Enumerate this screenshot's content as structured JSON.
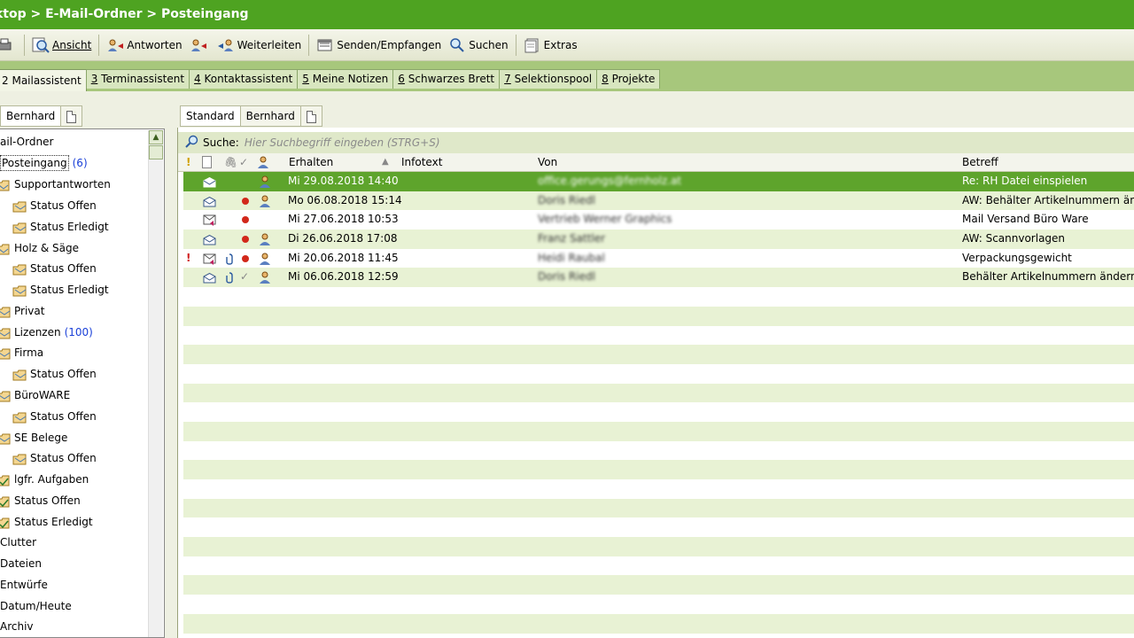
{
  "title": "ktop > E-Mail-Ordner > Posteingang",
  "toolbar": {
    "buttons": [
      {
        "label": "Ansicht",
        "icon": "view-icon"
      },
      {
        "label": "Antworten",
        "icon": "reply-icon"
      },
      {
        "label": "Weiterleiten",
        "icon": "forward-icon"
      },
      {
        "label": "Senden/Empfangen",
        "icon": "send-receive-icon"
      },
      {
        "label": "Suchen",
        "icon": "search-icon"
      },
      {
        "label": "Extras",
        "icon": "extras-icon"
      }
    ]
  },
  "main_tabs": [
    {
      "num": "2",
      "label": "Mailassistent"
    },
    {
      "num": "3",
      "label": "Terminassistent"
    },
    {
      "num": "4",
      "label": "Kontaktassistent"
    },
    {
      "num": "5",
      "label": "Meine Notizen"
    },
    {
      "num": "6",
      "label": "Schwarzes Brett"
    },
    {
      "num": "7",
      "label": "Selektionspool"
    },
    {
      "num": "8",
      "label": "Projekte"
    }
  ],
  "left_tabs": {
    "user": "Bernhard"
  },
  "tree": [
    {
      "label": "ail-Ordner",
      "count": ""
    },
    {
      "label": "Posteingang",
      "count": "(6)"
    },
    {
      "label": "Supportantworten",
      "count": ""
    },
    {
      "label": "Status Offen",
      "count": ""
    },
    {
      "label": "Status Erledigt",
      "count": ""
    },
    {
      "label": "Holz & Säge",
      "count": ""
    },
    {
      "label": "Status Offen",
      "count": ""
    },
    {
      "label": "Status Erledigt",
      "count": ""
    },
    {
      "label": "Privat",
      "count": ""
    },
    {
      "label": "Lizenzen",
      "count": "(100)"
    },
    {
      "label": "Firma",
      "count": ""
    },
    {
      "label": "Status Offen",
      "count": ""
    },
    {
      "label": "BüroWARE",
      "count": ""
    },
    {
      "label": "Status Offen",
      "count": ""
    },
    {
      "label": "SE Belege",
      "count": ""
    },
    {
      "label": "Status Offen",
      "count": ""
    },
    {
      "label": "lgfr. Aufgaben",
      "count": ""
    },
    {
      "label": "Status Offen",
      "count": ""
    },
    {
      "label": "Status Erledigt",
      "count": ""
    },
    {
      "label": "Clutter",
      "count": ""
    },
    {
      "label": "Dateien",
      "count": ""
    },
    {
      "label": "Entwürfe",
      "count": ""
    },
    {
      "label": "Datum/Heute",
      "count": ""
    },
    {
      "label": "Archiv",
      "count": ""
    }
  ],
  "right_tabs": {
    "standard": "Standard",
    "user": "Bernhard"
  },
  "search": {
    "label": "Suche:",
    "placeholder": "Hier Suchbegriff eingeben (STRG+S)"
  },
  "columns": {
    "flag": "!",
    "received": "Erhalten",
    "info": "Infotext",
    "from": "Von",
    "subject": "Betreff"
  },
  "emails": [
    {
      "received": "Mi 29.08.2018 14:40",
      "from": "office.gerungs@fernholz.at",
      "subject": "Re: RH Datei einspielen",
      "priority": "",
      "attachment": false,
      "done": false,
      "unread_dot": false,
      "selected": true
    },
    {
      "received": "Mo 06.08.2018 15:14",
      "from": "Doris Riedl",
      "subject": "AW: Behälter Artikelnummern ändern",
      "priority": "",
      "attachment": false,
      "done": false,
      "unread_dot": true,
      "selected": false
    },
    {
      "received": "Mi 27.06.2018 10:53",
      "from": "Vertrieb Werner Graphics",
      "subject": "Mail Versand Büro Ware",
      "priority": "",
      "attachment": false,
      "done": false,
      "unread_dot": true,
      "selected": false
    },
    {
      "received": "Di 26.06.2018 17:08",
      "from": "Franz Sattler",
      "subject": "AW: Scannvorlagen",
      "priority": "",
      "attachment": false,
      "done": false,
      "unread_dot": true,
      "selected": false
    },
    {
      "received": "Mi 20.06.2018 11:45",
      "from": "Heidi Raubal",
      "subject": "Verpackungsgewicht",
      "priority": "!",
      "attachment": true,
      "done": false,
      "unread_dot": true,
      "selected": false
    },
    {
      "received": "Mi 06.06.2018 12:59",
      "from": "Doris Riedl",
      "subject": "Behälter Artikelnummern ändern BW",
      "priority": "",
      "attachment": true,
      "done": true,
      "unread_dot": false,
      "selected": false
    }
  ],
  "colors": {
    "title_bar": "#4ea321",
    "selected_row": "#5ea42c",
    "alt_row": "#e8f2d4",
    "count_blue": "#1a40d8",
    "dot_red": "#d2281a"
  }
}
